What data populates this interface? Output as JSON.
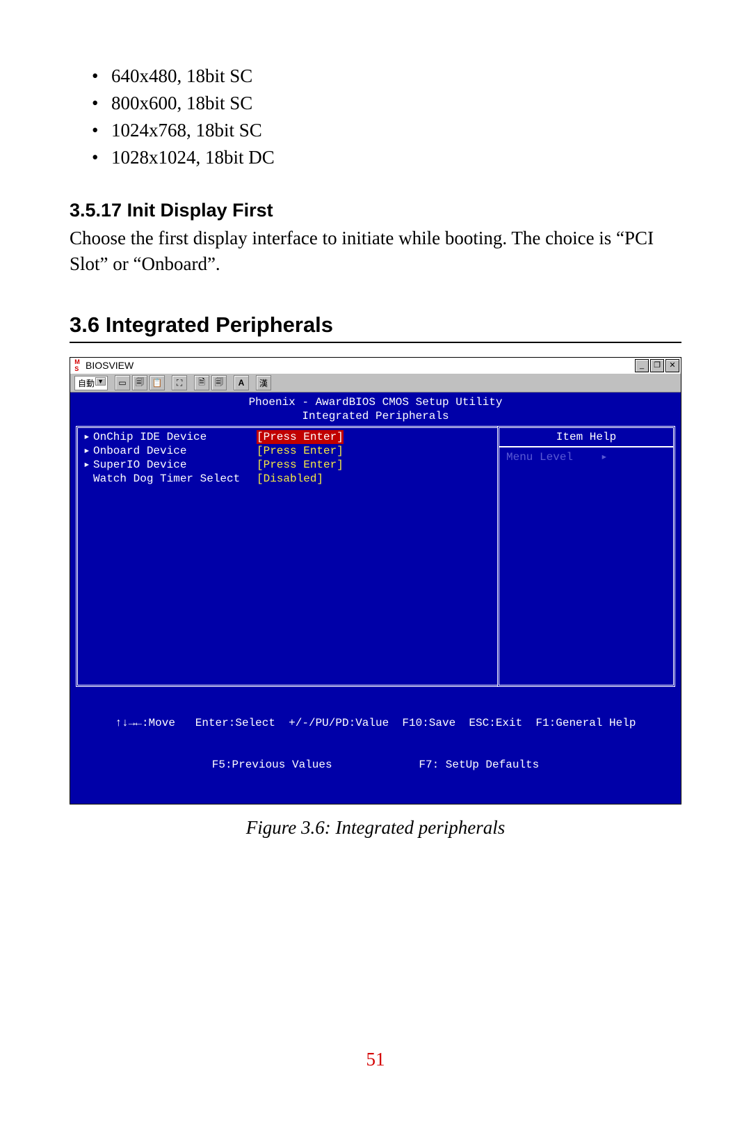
{
  "resolutions": [
    "640x480, 18bit SC",
    "800x600, 18bit SC",
    "1024x768, 18bit SC",
    "1028x1024, 18bit DC"
  ],
  "subheading": "3.5.17 Init Display First",
  "subbody": "Choose the first display interface to initiate while booting. The choice is “PCI Slot” or “Onboard”.",
  "section_heading": "3.6  Integrated Peripherals",
  "figure_caption": "Figure 3.6: Integrated peripherals",
  "page_number": "51",
  "bios": {
    "window_title": "BIOSVIEW",
    "toolbar_select": "自動",
    "win_buttons": {
      "min": "_",
      "max": "❐",
      "close": "✕"
    },
    "toolbar_icons": [
      "select-rect",
      "copy",
      "paste",
      "fit",
      "page1",
      "page2",
      "bold",
      "kanji"
    ],
    "toolbar_glyphs": {
      "select-rect": "▭",
      "copy": "🗐",
      "paste": "📋",
      "fit": "⛶",
      "page1": "🗎",
      "page2": "🗐",
      "bold": "A",
      "kanji": "漢"
    },
    "header_line1": "Phoenix - AwardBIOS CMOS Setup Utility",
    "header_line2": "Integrated Peripherals",
    "options": [
      {
        "arrow": true,
        "label": "OnChip IDE Device",
        "value": "[Press Enter]",
        "highlight": true
      },
      {
        "arrow": true,
        "label": "Onboard Device",
        "value": "[Press Enter]",
        "highlight": false
      },
      {
        "arrow": true,
        "label": "SuperIO Device",
        "value": "[Press Enter]",
        "highlight": false
      },
      {
        "arrow": false,
        "label": "Watch Dog Timer Select",
        "value": "[Disabled]",
        "highlight": false
      }
    ],
    "item_help": "Item Help",
    "menu_level": "Menu Level",
    "footer_line1": "↑↓→←:Move   Enter:Select  +/-/PU/PD:Value  F10:Save  ESC:Exit  F1:General Help",
    "footer_line2": "F5:Previous Values             F7: SetUp Defaults"
  }
}
